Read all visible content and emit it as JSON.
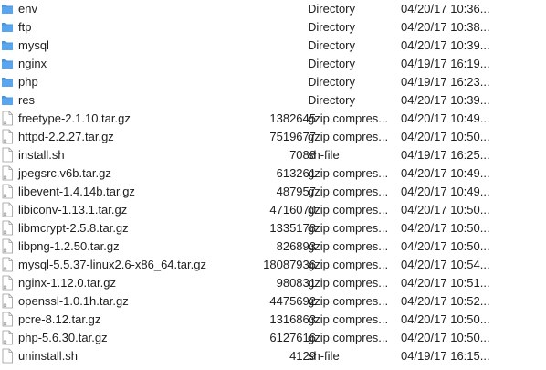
{
  "icons": {
    "folder": "folder-icon",
    "file": "document-icon",
    "archive": "archive-file-icon"
  },
  "colors": {
    "folder": "#5aa6ee",
    "folder_tab": "#4a93db",
    "file_border": "#9a9a9a",
    "text": "#1d1d1d"
  },
  "files": [
    {
      "name": "env",
      "size": "",
      "kind": "Directory",
      "date": "04/20/17 10:36...",
      "type": "folder"
    },
    {
      "name": "ftp",
      "size": "",
      "kind": "Directory",
      "date": "04/20/17 10:38...",
      "type": "folder"
    },
    {
      "name": "mysql",
      "size": "",
      "kind": "Directory",
      "date": "04/20/17 10:39...",
      "type": "folder"
    },
    {
      "name": "nginx",
      "size": "",
      "kind": "Directory",
      "date": "04/19/17 16:19...",
      "type": "folder"
    },
    {
      "name": "php",
      "size": "",
      "kind": "Directory",
      "date": "04/19/17 16:23...",
      "type": "folder"
    },
    {
      "name": "res",
      "size": "",
      "kind": "Directory",
      "date": "04/20/17 10:39...",
      "type": "folder"
    },
    {
      "name": "freetype-2.1.10.tar.gz",
      "size": "1382645",
      "kind": "gzip compres...",
      "date": "04/20/17 10:49...",
      "type": "archive"
    },
    {
      "name": "httpd-2.2.27.tar.gz",
      "size": "7519677",
      "kind": "gzip compres...",
      "date": "04/20/17 10:50...",
      "type": "archive"
    },
    {
      "name": "install.sh",
      "size": "7088",
      "kind": "sh-file",
      "date": "04/19/17 16:25...",
      "type": "file"
    },
    {
      "name": "jpegsrc.v6b.tar.gz",
      "size": "613261",
      "kind": "gzip compres...",
      "date": "04/20/17 10:49...",
      "type": "archive"
    },
    {
      "name": "libevent-1.4.14b.tar.gz",
      "size": "487957",
      "kind": "gzip compres...",
      "date": "04/20/17 10:49...",
      "type": "archive"
    },
    {
      "name": "libiconv-1.13.1.tar.gz",
      "size": "4716070",
      "kind": "gzip compres...",
      "date": "04/20/17 10:50...",
      "type": "archive"
    },
    {
      "name": "libmcrypt-2.5.8.tar.gz",
      "size": "1335178",
      "kind": "gzip compres...",
      "date": "04/20/17 10:50...",
      "type": "archive"
    },
    {
      "name": "libpng-1.2.50.tar.gz",
      "size": "826893",
      "kind": "gzip compres...",
      "date": "04/20/17 10:50...",
      "type": "archive"
    },
    {
      "name": "mysql-5.5.37-linux2.6-x86_64.tar.gz",
      "size": "18087936",
      "kind": "gzip compres...",
      "date": "04/20/17 10:54...",
      "type": "archive"
    },
    {
      "name": "nginx-1.12.0.tar.gz",
      "size": "980831",
      "kind": "gzip compres...",
      "date": "04/20/17 10:51...",
      "type": "archive"
    },
    {
      "name": "openssl-1.0.1h.tar.gz",
      "size": "4475692",
      "kind": "gzip compres...",
      "date": "04/20/17 10:52...",
      "type": "archive"
    },
    {
      "name": "pcre-8.12.tar.gz",
      "size": "1316863",
      "kind": "gzip compres...",
      "date": "04/20/17 10:50...",
      "type": "archive"
    },
    {
      "name": "php-5.6.30.tar.gz",
      "size": "6127616",
      "kind": "gzip compres...",
      "date": "04/20/17 10:50...",
      "type": "archive"
    },
    {
      "name": "uninstall.sh",
      "size": "4129",
      "kind": "sh-file",
      "date": "04/19/17 16:15...",
      "type": "file"
    }
  ]
}
